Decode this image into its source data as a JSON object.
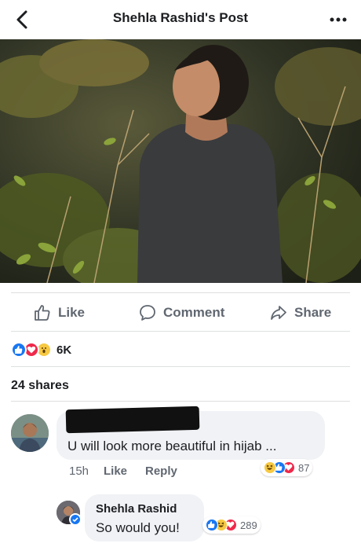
{
  "header": {
    "title": "Shehla Rashid's Post",
    "back_icon": "chevron-left-icon",
    "more_icon": "ellipsis-icon"
  },
  "post": {
    "photo_alt": "photo"
  },
  "actions": {
    "like_label": "Like",
    "comment_label": "Comment",
    "share_label": "Share"
  },
  "reactions": {
    "types": [
      "like",
      "love",
      "wow"
    ],
    "count": "6K"
  },
  "shares": {
    "label": "24 shares"
  },
  "comments": [
    {
      "author_redacted": true,
      "text": "U will look more beautiful in hijab ...",
      "time": "15h",
      "like_label": "Like",
      "reply_label": "Reply",
      "reactions": [
        "haha",
        "like",
        "love"
      ],
      "reaction_count": "87"
    },
    {
      "author": "Shehla Rashid",
      "text": "So would you!",
      "verified": true,
      "reactions": [
        "like",
        "haha",
        "love"
      ],
      "reaction_count": "289"
    }
  ],
  "colors": {
    "brand_blue": "#1877f2",
    "love_red": "#f0284a",
    "haha_yellow": "#f7c943",
    "bubble_gray": "#f0f2f5",
    "text_muted": "#606770"
  }
}
